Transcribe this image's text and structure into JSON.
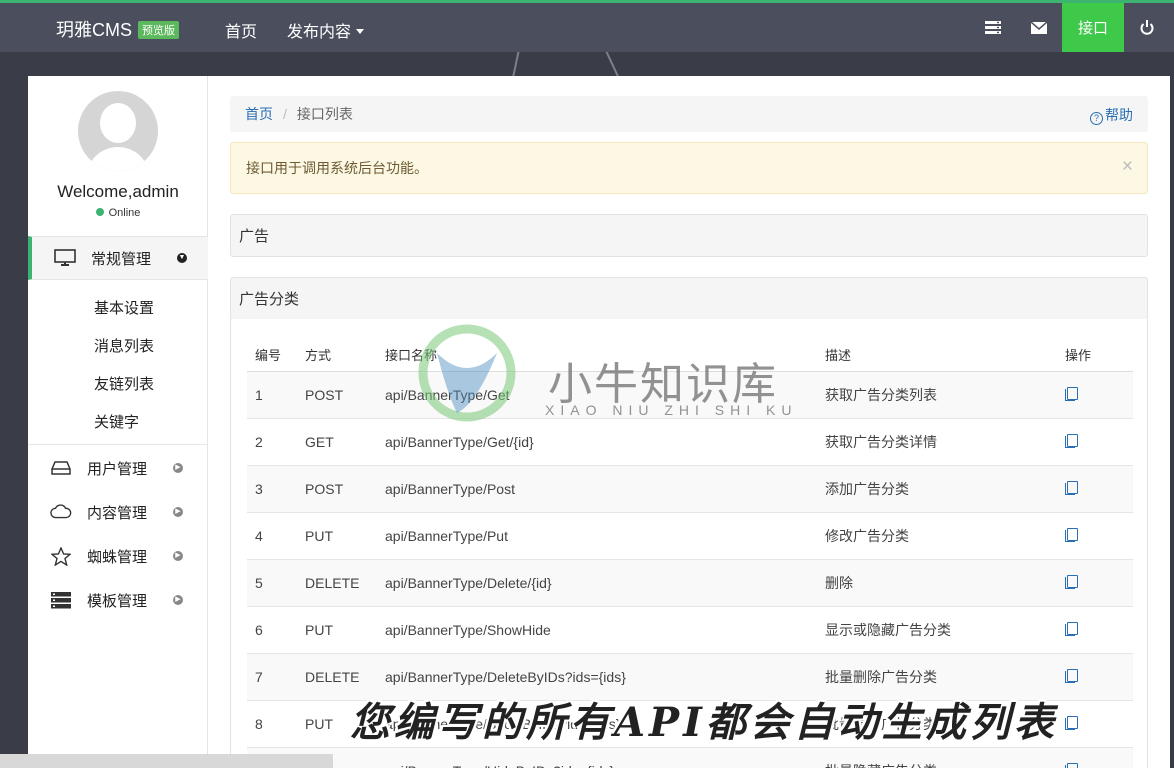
{
  "brand": {
    "name": "玥雅CMS",
    "badge": "预览版"
  },
  "topnav": {
    "home": "首页",
    "publish": "发布内容",
    "api": "接口"
  },
  "user": {
    "welcome": "Welcome,admin",
    "status": "Online"
  },
  "sidebar": {
    "groups": [
      {
        "label": "常规管理",
        "icon": "monitor-icon"
      },
      {
        "label": "用户管理",
        "icon": "drive-icon"
      },
      {
        "label": "内容管理",
        "icon": "cloud-icon"
      },
      {
        "label": "蜘蛛管理",
        "icon": "star-icon"
      },
      {
        "label": "模板管理",
        "icon": "server-icon"
      }
    ],
    "subitems": [
      "基本设置",
      "消息列表",
      "友链列表",
      "关键字"
    ]
  },
  "breadcrumb": {
    "home": "首页",
    "current": "接口列表",
    "help": "帮助"
  },
  "alert": {
    "text": "接口用于调用系统后台功能。",
    "close": "×"
  },
  "sections": {
    "ad": "广告",
    "ad_category": "广告分类"
  },
  "table": {
    "headers": [
      "编号",
      "方式",
      "接口名称",
      "描述",
      "操作"
    ],
    "rows": [
      {
        "no": "1",
        "method": "POST",
        "path": "api/BannerType/Get",
        "desc": "获取广告分类列表"
      },
      {
        "no": "2",
        "method": "GET",
        "path": "api/BannerType/Get/{id}",
        "desc": "获取广告分类详情"
      },
      {
        "no": "3",
        "method": "POST",
        "path": "api/BannerType/Post",
        "desc": "添加广告分类"
      },
      {
        "no": "4",
        "method": "PUT",
        "path": "api/BannerType/Put",
        "desc": "修改广告分类"
      },
      {
        "no": "5",
        "method": "DELETE",
        "path": "api/BannerType/Delete/{id}",
        "desc": "删除"
      },
      {
        "no": "6",
        "method": "PUT",
        "path": "api/BannerType/ShowHide",
        "desc": "显示或隐藏广告分类"
      },
      {
        "no": "7",
        "method": "DELETE",
        "path": "api/BannerType/DeleteByIDs?ids={ids}",
        "desc": "批量删除广告分类"
      },
      {
        "no": "8",
        "method": "PUT",
        "path": "api/BannerType/ShowByIDs?ids={ids}",
        "desc": "批量显示广告分类"
      },
      {
        "no": "",
        "method": "",
        "path": "api/BannerType/HideByIDs?ids={ids}",
        "desc": "批量隐藏广告分类"
      }
    ]
  },
  "watermark": {
    "title": "小牛知识库",
    "subtitle": "XIAO NIU ZHI SHI KU"
  },
  "caption": "您编写的所有API都会自动生成列表",
  "colors": {
    "accent": "#3fc94a",
    "link": "#2a6eb5",
    "navbar": "#4b4f5d"
  }
}
